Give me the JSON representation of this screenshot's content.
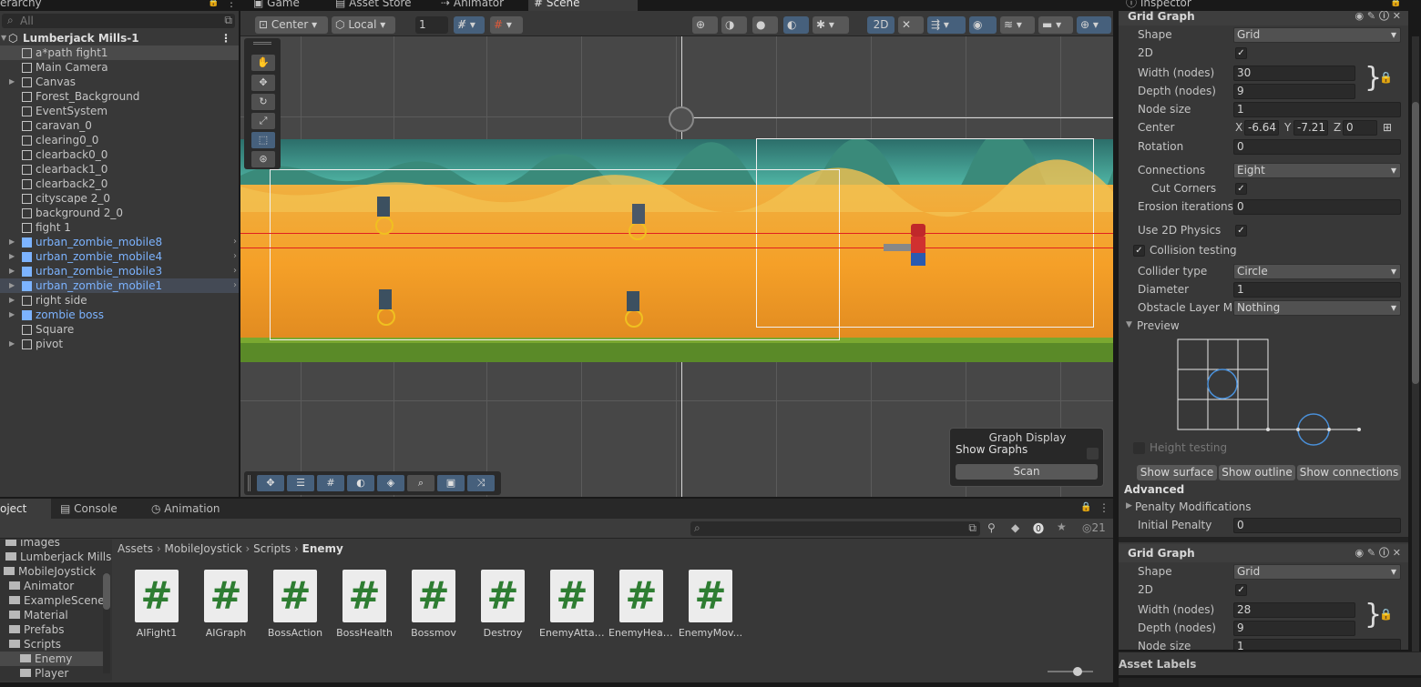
{
  "tabs": {
    "hierarchy": "erarchy",
    "game": "Game",
    "asset_store": "Asset Store",
    "animator": "Animator",
    "scene": "Scene",
    "inspector": "Inspector"
  },
  "hierarchy": {
    "search_placeholder": "All",
    "scene_name": "Lumberjack Mills-1",
    "items": [
      {
        "label": "a*path fight1"
      },
      {
        "label": "Main Camera"
      },
      {
        "label": "Canvas"
      },
      {
        "label": "Forest_Background"
      },
      {
        "label": "EventSystem"
      },
      {
        "label": "caravan_0"
      },
      {
        "label": "clearing0_0"
      },
      {
        "label": "clearback0_0"
      },
      {
        "label": "clearback1_0"
      },
      {
        "label": "clearback2_0"
      },
      {
        "label": "cityscape 2_0"
      },
      {
        "label": "background 2_0"
      },
      {
        "label": "fight 1"
      },
      {
        "label": "urban_zombie_mobile8"
      },
      {
        "label": "urban_zombie_mobile4"
      },
      {
        "label": "urban_zombie_mobile3"
      },
      {
        "label": "urban_zombie_mobile1"
      },
      {
        "label": "right side"
      },
      {
        "label": "zombie boss"
      },
      {
        "label": "Square"
      },
      {
        "label": "pivot"
      }
    ]
  },
  "scene_toolbar": {
    "pivot": "Center",
    "space": "Local",
    "snap_value": "1",
    "mode_2d": "2D"
  },
  "graph_display": {
    "title": "Graph Display",
    "show_graphs": "Show Graphs",
    "scan": "Scan"
  },
  "inspector": {
    "component1": {
      "title": "Grid Graph",
      "shape_label": "Shape",
      "shape_value": "Grid",
      "d2_label": "2D",
      "width_label": "Width (nodes)",
      "width_value": "30",
      "depth_label": "Depth (nodes)",
      "depth_value": "9",
      "nodesize_label": "Node size",
      "nodesize_value": "1",
      "center_label": "Center",
      "center_x": "-6.64",
      "center_y": "-7.21",
      "center_z": "0",
      "x": "X",
      "y": "Y",
      "z": "Z",
      "rotation_label": "Rotation",
      "rotation_value": "0",
      "connections_label": "Connections",
      "connections_value": "Eight",
      "cutcorners_label": "Cut Corners",
      "erosion_label": "Erosion iterations",
      "erosion_value": "0",
      "use2d_label": "Use 2D Physics",
      "collision_label": "Collision testing",
      "collider_label": "Collider type",
      "collider_value": "Circle",
      "diameter_label": "Diameter",
      "diameter_value": "1",
      "obstacle_label": "Obstacle Layer Ma",
      "obstacle_value": "Nothing",
      "preview_label": "Preview",
      "height_label": "Height testing",
      "show_surface": "Show surface",
      "show_outline": "Show outline",
      "show_connections": "Show connections",
      "advanced_label": "Advanced",
      "penalty_label": "Penalty Modifications",
      "initial_penalty_label": "Initial Penalty",
      "initial_penalty_value": "0"
    },
    "component2": {
      "title": "Grid Graph",
      "shape_label": "Shape",
      "shape_value": "Grid",
      "d2_label": "2D",
      "width_label": "Width (nodes)",
      "width_value": "28",
      "depth_label": "Depth (nodes)",
      "depth_value": "9",
      "nodesize_label": "Node size",
      "nodesize_value": "1"
    },
    "asset_labels": "Asset Labels"
  },
  "project": {
    "tab_project": "oject",
    "tab_console": "Console",
    "tab_animation": "Animation",
    "badge_count": "21",
    "breadcrumb": [
      "Assets",
      "MobileJoystick",
      "Scripts",
      "Enemy"
    ],
    "folders": [
      {
        "label": "Images"
      },
      {
        "label": "Lumberjack Mills-"
      },
      {
        "label": "MobileJoystick"
      },
      {
        "label": "Animator"
      },
      {
        "label": "ExampleScene"
      },
      {
        "label": "Material"
      },
      {
        "label": "Prefabs"
      },
      {
        "label": "Scripts"
      },
      {
        "label": "Enemy"
      },
      {
        "label": "Player"
      }
    ],
    "assets": [
      {
        "label": "AIFight1"
      },
      {
        "label": "AIGraph"
      },
      {
        "label": "BossAction"
      },
      {
        "label": "BossHealth"
      },
      {
        "label": "Bossmov"
      },
      {
        "label": "Destroy"
      },
      {
        "label": "EnemyAttack"
      },
      {
        "label": "EnemyHealth"
      },
      {
        "label": "EnemyMov..."
      }
    ],
    "script_glyph": "#"
  }
}
